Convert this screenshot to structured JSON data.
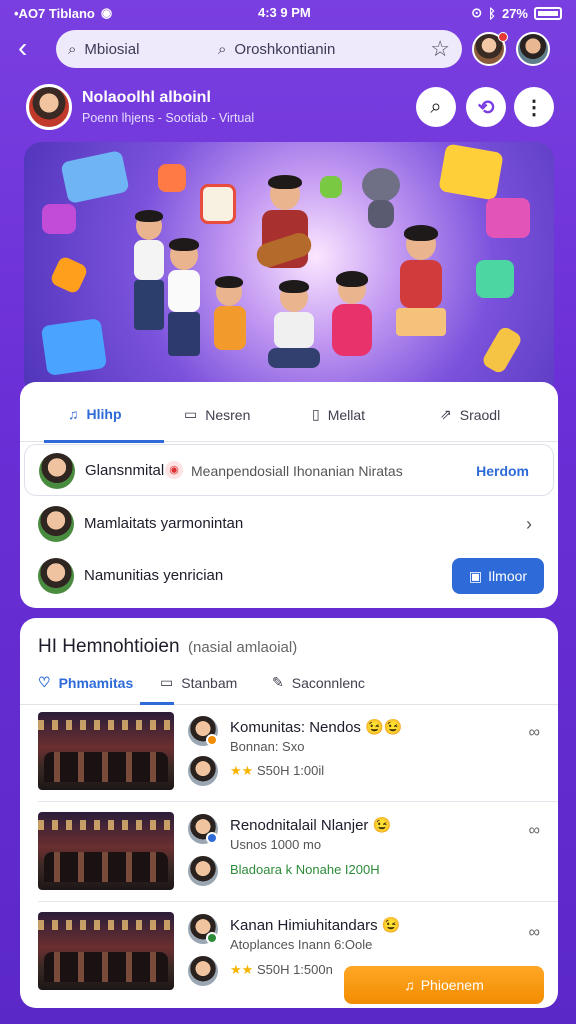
{
  "status_bar": {
    "carrier": "•AO7 Tiblano",
    "time": "4:3 9 PM",
    "battery": "27%"
  },
  "search": {
    "left_text": "Mbiosial",
    "right_text": "Oroshkontianin"
  },
  "profile": {
    "name": "Nolaoolhl alboinl",
    "subtitle": "Poenn lhjens - Sootiab - Virtual"
  },
  "tabs": [
    {
      "label": "Hlihp",
      "icon": "music-icon"
    },
    {
      "label": "Nesren",
      "icon": "chat-icon"
    },
    {
      "label": "Mellat",
      "icon": "phone-icon"
    },
    {
      "label": "Sraodl",
      "icon": "share-icon"
    }
  ],
  "list": [
    {
      "title": "Glansnmital",
      "detail": "Meanpendosiall Ihonanian Niratas",
      "action": "Herdom"
    },
    {
      "title": "Mamlaitats yarmonintan"
    },
    {
      "title": "Namunitias yenrician",
      "button": "Ilmoor"
    }
  ],
  "section": {
    "title": "HI Hemnohtioien",
    "subtitle": "(nasial amlaoial)",
    "tabs": [
      {
        "label": "Phmamitas",
        "icon": "heart-icon"
      },
      {
        "label": "Stanbam",
        "icon": "chat-icon"
      },
      {
        "label": "Saconnlenc",
        "icon": "edit-icon"
      }
    ]
  },
  "items": [
    {
      "name": "Komunitas: Nendos",
      "emoji": "😉😉",
      "line2": "Bonnan: Sxo",
      "line3": "S50H 1:00il",
      "stars": "★★"
    },
    {
      "name": "Renodnitalail Nlanjer",
      "emoji": "😉",
      "line2": "Usnos 1000 mo",
      "line3": "Bladoara k Nonahe I200H"
    },
    {
      "name": "Kanan Himiuhitandars",
      "emoji": "😉",
      "line2": "Atoplances Inann 6:Oole",
      "line3": "S50H 1:500n",
      "stars": "★★"
    }
  ],
  "bottom_button": "Phioenem",
  "colors": {
    "accent": "#2f6bd8",
    "brand": "#6a2fd6",
    "orange": "#f28c00"
  }
}
